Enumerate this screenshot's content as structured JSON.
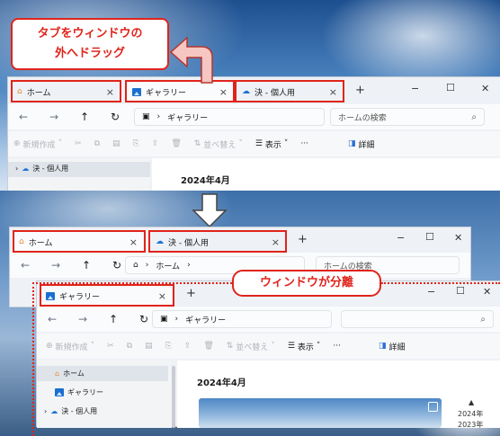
{
  "callouts": {
    "drag_line1": "タブをウィンドウの",
    "drag_line2": "外へドラッグ",
    "separated": "ウィンドウが分離"
  },
  "top_window": {
    "tabs": [
      {
        "label": "ホーム",
        "icon": "home-icon"
      },
      {
        "label": "ギャラリー",
        "icon": "gallery-icon"
      },
      {
        "label": "決 - 個人用",
        "icon": "cloud-icon"
      }
    ],
    "close_glyph": "×",
    "new_tab": "+",
    "controls": {
      "min": "−",
      "max": "☐",
      "close": "✕"
    },
    "breadcrumb": "ギャラリー",
    "search_placeholder": "ホームの検索",
    "commands": {
      "new": "新規作成",
      "sort": "並べ替え",
      "view": "表示",
      "more": "···",
      "details": "詳細"
    },
    "nav_item": "決 - 個人用",
    "section_heading": "2024年4月"
  },
  "bottom_back_window": {
    "tabs": [
      {
        "label": "ホーム",
        "icon": "home-icon"
      },
      {
        "label": "決 - 個人用",
        "icon": "cloud-icon"
      }
    ],
    "breadcrumb": "ホーム",
    "search_placeholder": "ホームの検索"
  },
  "bottom_front_window": {
    "tabs": [
      {
        "label": "ギャラリー",
        "icon": "gallery-icon"
      }
    ],
    "breadcrumb": "ギャラリー",
    "commands": {
      "new": "新規作成",
      "sort": "並べ替え",
      "view": "表示",
      "more": "···",
      "details": "詳細"
    },
    "nav_items": [
      {
        "label": "ホーム",
        "icon": "home-icon"
      },
      {
        "label": "ギャラリー",
        "icon": "gallery-icon"
      },
      {
        "label": "決 - 個人用",
        "icon": "cloud-icon"
      }
    ],
    "section_heading": "2024年4月",
    "timeline": [
      "2024年",
      "2023年"
    ]
  },
  "colors": {
    "annotation": "#e0241b",
    "accent": "#2b6fd8"
  }
}
